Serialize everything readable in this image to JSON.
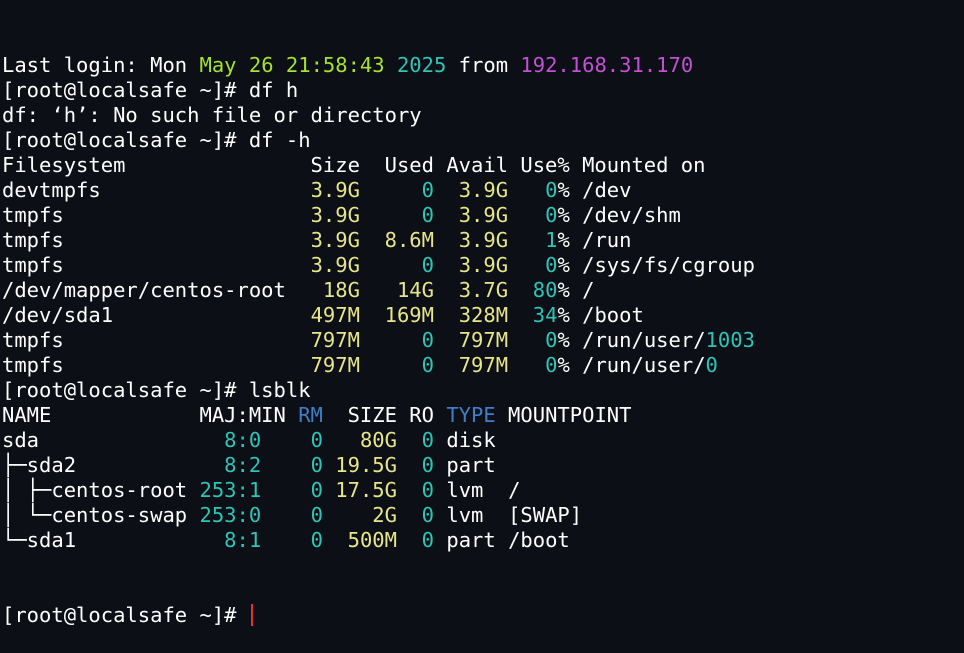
{
  "terminal": {
    "lines": [
      [
        [
          "Last login: Mon ",
          ""
        ],
        [
          "May 26 21:58:43",
          "green"
        ],
        [
          " ",
          ""
        ],
        [
          "2025",
          "cyan"
        ],
        [
          " from ",
          ""
        ],
        [
          "192.168.31.170",
          "purple"
        ]
      ],
      [
        [
          "[root@localsafe ~]# df h",
          ""
        ]
      ],
      [
        [
          "df: ‘h’: No such file or directory",
          ""
        ]
      ],
      [
        [
          "[root@localsafe ~]# df -h",
          ""
        ]
      ],
      [
        [
          "Filesystem               Size  Used Avail Use% Mounted on",
          ""
        ]
      ],
      [
        [
          "devtmpfs                 ",
          ""
        ],
        [
          "3.9G",
          "yellow"
        ],
        [
          "     ",
          ""
        ],
        [
          "0",
          "cyan"
        ],
        [
          "  ",
          ""
        ],
        [
          "3.9G",
          "yellow"
        ],
        [
          "   ",
          ""
        ],
        [
          "0",
          "cyan"
        ],
        [
          "% /dev",
          ""
        ]
      ],
      [
        [
          "tmpfs                    ",
          ""
        ],
        [
          "3.9G",
          "yellow"
        ],
        [
          "     ",
          ""
        ],
        [
          "0",
          "cyan"
        ],
        [
          "  ",
          ""
        ],
        [
          "3.9G",
          "yellow"
        ],
        [
          "   ",
          ""
        ],
        [
          "0",
          "cyan"
        ],
        [
          "% /dev/shm",
          ""
        ]
      ],
      [
        [
          "tmpfs                    ",
          ""
        ],
        [
          "3.9G",
          "yellow"
        ],
        [
          "  ",
          ""
        ],
        [
          "8.6M",
          "yellow"
        ],
        [
          "  ",
          ""
        ],
        [
          "3.9G",
          "yellow"
        ],
        [
          "   ",
          ""
        ],
        [
          "1",
          "cyan"
        ],
        [
          "% /run",
          ""
        ]
      ],
      [
        [
          "tmpfs                    ",
          ""
        ],
        [
          "3.9G",
          "yellow"
        ],
        [
          "     ",
          ""
        ],
        [
          "0",
          "cyan"
        ],
        [
          "  ",
          ""
        ],
        [
          "3.9G",
          "yellow"
        ],
        [
          "   ",
          ""
        ],
        [
          "0",
          "cyan"
        ],
        [
          "% /sys/fs/cgroup",
          ""
        ]
      ],
      [
        [
          "/dev/mapper/centos-root   ",
          ""
        ],
        [
          "18G",
          "yellow"
        ],
        [
          "   ",
          ""
        ],
        [
          "14G",
          "yellow"
        ],
        [
          "  ",
          ""
        ],
        [
          "3.7G",
          "yellow"
        ],
        [
          "  ",
          ""
        ],
        [
          "80",
          "cyan"
        ],
        [
          "% /",
          ""
        ]
      ],
      [
        [
          "/dev/sda1                ",
          ""
        ],
        [
          "497M",
          "yellow"
        ],
        [
          "  ",
          ""
        ],
        [
          "169M",
          "yellow"
        ],
        [
          "  ",
          ""
        ],
        [
          "328M",
          "yellow"
        ],
        [
          "  ",
          ""
        ],
        [
          "34",
          "cyan"
        ],
        [
          "% /boot",
          ""
        ]
      ],
      [
        [
          "tmpfs                    ",
          ""
        ],
        [
          "797M",
          "yellow"
        ],
        [
          "     ",
          ""
        ],
        [
          "0",
          "cyan"
        ],
        [
          "  ",
          ""
        ],
        [
          "797M",
          "yellow"
        ],
        [
          "   ",
          ""
        ],
        [
          "0",
          "cyan"
        ],
        [
          "% /run/user/",
          ""
        ],
        [
          "1003",
          "cyan"
        ]
      ],
      [
        [
          "tmpfs                    ",
          ""
        ],
        [
          "797M",
          "yellow"
        ],
        [
          "     ",
          ""
        ],
        [
          "0",
          "cyan"
        ],
        [
          "  ",
          ""
        ],
        [
          "797M",
          "yellow"
        ],
        [
          "   ",
          ""
        ],
        [
          "0",
          "cyan"
        ],
        [
          "% /run/user/",
          ""
        ],
        [
          "0",
          "cyan"
        ]
      ],
      [
        [
          "[root@localsafe ~]# lsblk",
          ""
        ]
      ],
      [
        [
          "NAME            MAJ:MIN ",
          ""
        ],
        [
          "RM",
          "blue"
        ],
        [
          "  SIZE RO ",
          ""
        ],
        [
          "TYPE",
          "blue"
        ],
        [
          " MOUNTPOINT",
          ""
        ]
      ],
      [
        [
          "sda               ",
          ""
        ],
        [
          "8:0",
          "cyan"
        ],
        [
          "    ",
          ""
        ],
        [
          "0",
          "cyan"
        ],
        [
          "   ",
          ""
        ],
        [
          "80G",
          "yellow"
        ],
        [
          "  ",
          ""
        ],
        [
          "0",
          "cyan"
        ],
        [
          " disk",
          ""
        ]
      ],
      [
        [
          "├─sda2            ",
          ""
        ],
        [
          "8:2",
          "cyan"
        ],
        [
          "    ",
          ""
        ],
        [
          "0",
          "cyan"
        ],
        [
          " ",
          ""
        ],
        [
          "19.5G",
          "yellow"
        ],
        [
          "  ",
          ""
        ],
        [
          "0",
          "cyan"
        ],
        [
          " part",
          ""
        ]
      ],
      [
        [
          "│ ├─centos-root ",
          ""
        ],
        [
          "253:1",
          "cyan"
        ],
        [
          "    ",
          ""
        ],
        [
          "0",
          "cyan"
        ],
        [
          " ",
          ""
        ],
        [
          "17.5G",
          "yellow"
        ],
        [
          "  ",
          ""
        ],
        [
          "0",
          "cyan"
        ],
        [
          " lvm  /",
          ""
        ]
      ],
      [
        [
          "│ └─centos-swap ",
          ""
        ],
        [
          "253:0",
          "cyan"
        ],
        [
          "    ",
          ""
        ],
        [
          "0",
          "cyan"
        ],
        [
          "    ",
          ""
        ],
        [
          "2G",
          "yellow"
        ],
        [
          "  ",
          ""
        ],
        [
          "0",
          "cyan"
        ],
        [
          " lvm  [SWAP]",
          ""
        ]
      ],
      [
        [
          "└─sda1            ",
          ""
        ],
        [
          "8:1",
          "cyan"
        ],
        [
          "    ",
          ""
        ],
        [
          "0",
          "cyan"
        ],
        [
          "  ",
          ""
        ],
        [
          "500M",
          "yellow"
        ],
        [
          "  ",
          ""
        ],
        [
          "0",
          "cyan"
        ],
        [
          " part /boot",
          ""
        ]
      ]
    ],
    "prompt": "[root@localsafe ~]# "
  },
  "colors": {
    "background": "#0c0f15",
    "text": "#ffffff",
    "green": "#a6e22e",
    "cyan": "#2ec4b6",
    "purple": "#c450d6",
    "yellow": "#e8e58a",
    "blue": "#3f7fc7",
    "cursor": "#e0303a"
  }
}
